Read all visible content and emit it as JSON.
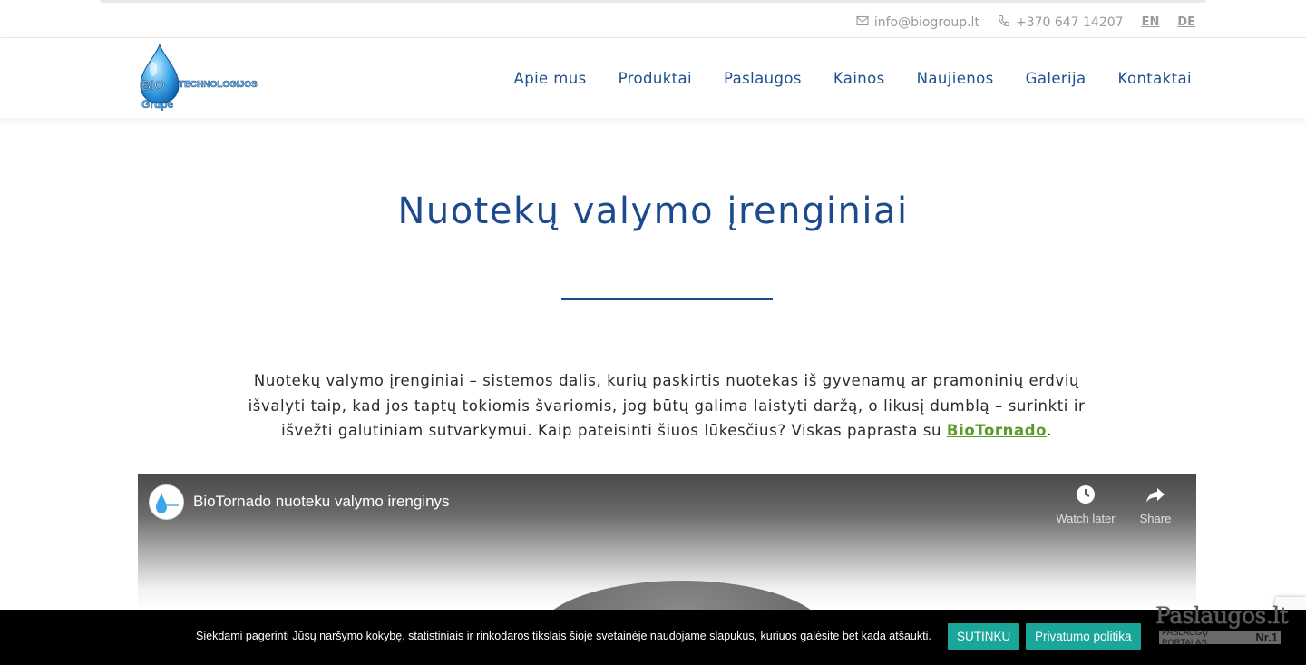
{
  "topbar": {
    "email": "info@biogroup.lt",
    "phone": "+370 647 14207",
    "languages": [
      "EN",
      "DE"
    ]
  },
  "logo": {
    "text_bio": "BIO",
    "text_tech": "TECHNOLOGIJOS",
    "text_group": "Grupė"
  },
  "nav": {
    "items": [
      "Apie mus",
      "Produktai",
      "Paslaugos",
      "Kainos",
      "Naujienos",
      "Galerija",
      "Kontaktai"
    ]
  },
  "main": {
    "title": "Nuotekų valymo įrenginiai",
    "intro_text": "Nuotekų valymo įrenginiai – sistemos dalis, kurių paskirtis nuotekas iš gyvenamų ar pramoninių erdvių išvalyti taip, kad jos taptų tokiomis švariomis, jog būtų galima laistyti daržą, o likusį dumblą – surinkti ir išvežti galutiniam sutvarkymui. Kaip pateisinti šiuos lūkesčius? Viskas paprasta su ",
    "intro_link": "BioTornado",
    "intro_end": "."
  },
  "video": {
    "title": "BioTornado nuoteku valymo irenginys",
    "watch_later": "Watch later",
    "share": "Share"
  },
  "cookie": {
    "text": "Siekdami pagerinti Jūsų naršymo kokybę, statistiniais ir rinkodaros tikslais šioje svetainėje naudojame slapukus, kuriuos galėsite bet kada atšaukti.",
    "agree_label": "SUTINKU",
    "privacy_label": "Privatumo politika"
  },
  "portal_badge": {
    "name": "Paslaugos.lt",
    "sub": "PASLAUGŲ PORTALAS",
    "rank": "Nr.1"
  },
  "colors": {
    "brand_blue": "#1c4a8e",
    "link_green": "#5a9a2a",
    "cookie_button": "#1aa79a"
  }
}
